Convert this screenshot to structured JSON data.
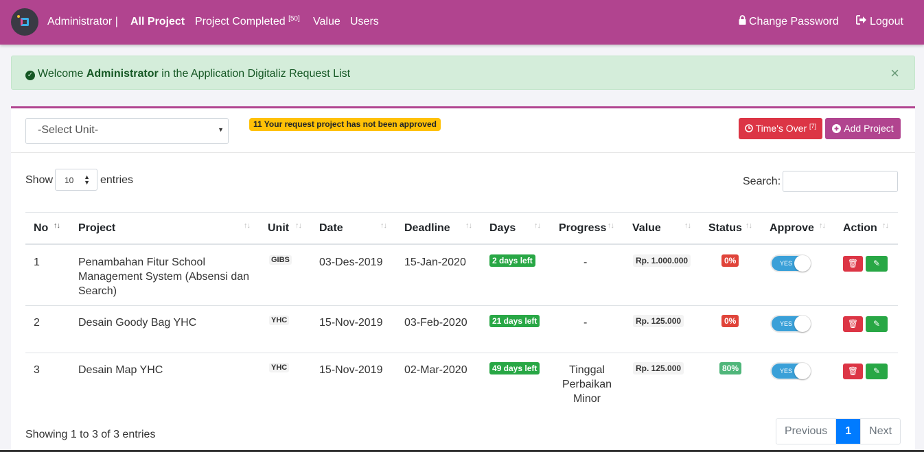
{
  "navbar": {
    "user_label": "Administrator |",
    "all_project": "All Project",
    "project_completed": "Project Completed",
    "project_completed_count": "[50]",
    "value": "Value",
    "users": "Users",
    "change_password": "Change Password",
    "logout": "Logout",
    "accent_color": "#b1448f"
  },
  "alert": {
    "prefix": "Welcome",
    "name": "Administrator",
    "suffix": "in the Application Digitaliz Request List",
    "close": "×"
  },
  "toolbar": {
    "select_unit": "-Select Unit-",
    "warning": "11 Your request project has not been approved",
    "times_over": "Time's Over",
    "times_over_count": "[7]",
    "add_project": "Add Project"
  },
  "table_controls": {
    "show": "Show",
    "length": "10",
    "entries": "entries",
    "search": "Search:"
  },
  "columns": [
    "No",
    "Project",
    "Unit",
    "Date",
    "Deadline",
    "Days",
    "Progress",
    "Value",
    "Status",
    "Approve",
    "Action"
  ],
  "rows": [
    {
      "no": "1",
      "project_lines": [
        "Penambahan Fitur School",
        "Management System (Absensi dan",
        "Search)"
      ],
      "unit": "GIBS",
      "date": "03-Des-2019",
      "deadline": "15-Jan-2020",
      "days": "2 days left",
      "progress_lines": [
        "-"
      ],
      "value": "Rp. 1.000.000",
      "status": "0%",
      "approve": "YES"
    },
    {
      "no": "2",
      "project_lines": [
        "Desain Goody Bag YHC"
      ],
      "unit": "YHC",
      "date": "15-Nov-2019",
      "deadline": "03-Feb-2020",
      "days": "21 days left",
      "progress_lines": [
        "-"
      ],
      "value": "Rp. 125.000",
      "status": "0%",
      "approve": "YES"
    },
    {
      "no": "3",
      "project_lines": [
        "Desain Map YHC"
      ],
      "unit": "YHC",
      "date": "15-Nov-2019",
      "deadline": "02-Mar-2020",
      "days": "49 days left",
      "progress_lines": [
        "Tinggal",
        "Perbaikan",
        "Minor"
      ],
      "value": "Rp. 125.000",
      "status": "80%",
      "approve": "YES"
    }
  ],
  "footer": {
    "info": "Showing 1 to 3 of 3 entries",
    "previous": "Previous",
    "page": "1",
    "next": "Next"
  },
  "colors": {
    "status_low": "#e0443a",
    "status_high": "#4fb67a",
    "days_badge": "#28a745",
    "delete": "#dc3545",
    "edit": "#28a745"
  },
  "icons": [
    "logo",
    "lock-icon",
    "logout-icon",
    "check-circle-icon",
    "clock-icon",
    "plus-circle-icon",
    "trash-icon",
    "edit-icon",
    "sort-icon"
  ]
}
